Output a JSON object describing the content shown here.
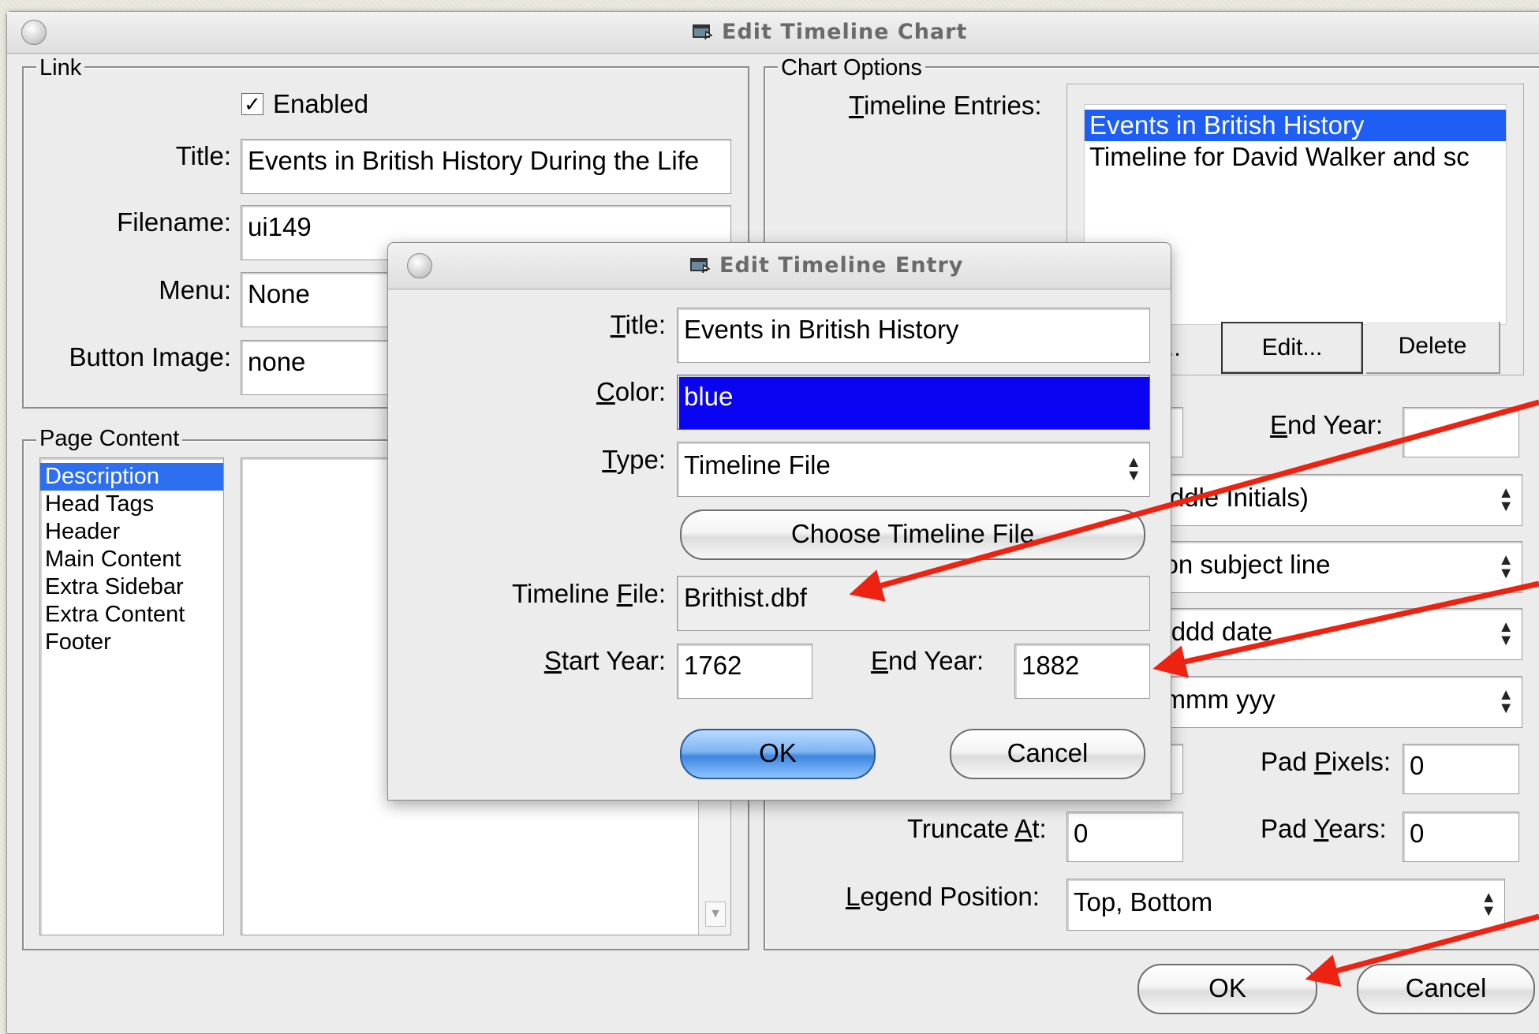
{
  "main_window": {
    "title": "Edit Timeline Chart",
    "link_group": {
      "label": "Link",
      "enabled_label": "Enabled",
      "enabled_checked": true,
      "title_label": "Title:",
      "title_value": "Events in British History During the Life",
      "filename_label": "Filename:",
      "filename_value": "ui149",
      "menu_label": "Menu:",
      "menu_value": "None",
      "button_image_label": "Button Image:",
      "button_image_value": "none"
    },
    "page_content_group": {
      "label": "Page Content",
      "items": [
        "Description",
        "Head Tags",
        "Header",
        "Main Content",
        "Extra Sidebar",
        "Extra Content",
        "Footer"
      ],
      "selected_index": 0
    },
    "chart_options_group": {
      "label": "Chart Options",
      "timeline_entries_label": "Timeline Entries:",
      "entries": [
        "Events in British History",
        "Timeline for David Walker and sc"
      ],
      "selected_index": 0,
      "add_button_partial": "..",
      "edit_button": "Edit...",
      "delete_button": "Delete",
      "end_year_label": "End Year:",
      "end_year_value": "",
      "names_select_partial": "Middle Initials)",
      "subject_select_partial": "n on subject line",
      "date_select_partial": "e, ddd date",
      "month_select_partial": "Mmmm yyy",
      "pad_pixels_label": "Pad Pixels:",
      "pad_pixels_value": "0",
      "truncate_at_label": "Truncate At:",
      "truncate_at_value": "0",
      "pad_years_label": "Pad Years:",
      "pad_years_value": "0",
      "legend_position_label": "Legend Position:",
      "legend_position_value": "Top, Bottom"
    },
    "ok_button": "OK",
    "cancel_button": "Cancel"
  },
  "entry_dialog": {
    "title": "Edit Timeline Entry",
    "title_label": "Title:",
    "title_value": "Events in British History",
    "color_label": "Color:",
    "color_value": "blue",
    "color_swatch": "#0a04f5",
    "type_label": "Type:",
    "type_value": "Timeline File",
    "choose_button": "Choose Timeline File",
    "timeline_file_label": "Timeline File:",
    "timeline_file_value": "Brithist.dbf",
    "start_year_label": "Start Year:",
    "start_year_value": "1762",
    "end_year_label": "End Year:",
    "end_year_value": "1882",
    "ok_button": "OK",
    "cancel_button": "Cancel"
  },
  "annotation_color": "#ee2211"
}
